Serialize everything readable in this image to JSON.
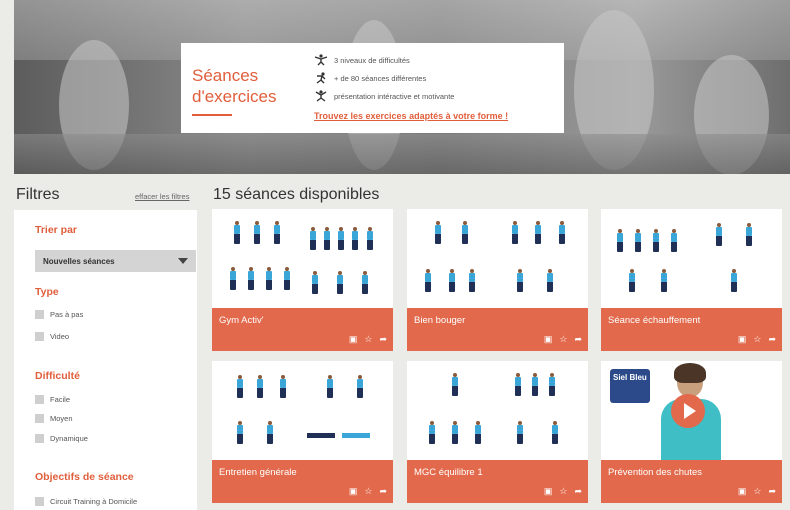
{
  "hero": {
    "title_line1": "Séances",
    "title_line2": "d'exercices",
    "features": [
      {
        "icon": "gymnast-icon",
        "text": "3 niveaux de difficultés"
      },
      {
        "icon": "runner-icon",
        "text": "+ de 80 séances différentes"
      },
      {
        "icon": "star-person-icon",
        "text": "présentation intéractive et motivante"
      }
    ],
    "link": "Trouvez les exercices adaptés à votre forme !"
  },
  "filters": {
    "title": "Filtres",
    "clear": "effacer les filtres",
    "sort_heading": "Trier par",
    "sort_value": "Nouvelles séances",
    "type_heading": "Type",
    "types": [
      "Pas à pas",
      "Video"
    ],
    "difficulty_heading": "Difficulté",
    "difficulties": [
      "Facile",
      "Moyen",
      "Dynamique"
    ],
    "objectives_heading": "Objectifs de séance",
    "objectives": [
      "Circuit Training à Domicile"
    ]
  },
  "main": {
    "count_title": "15 séances disponibles",
    "cards": [
      {
        "title": "Gym Activ'"
      },
      {
        "title": "Bien bouger"
      },
      {
        "title": "Séance échauffement"
      },
      {
        "title": "Entretien générale"
      },
      {
        "title": "MGC équilibre 1"
      },
      {
        "title": "Prévention des chutes"
      }
    ],
    "video_logo": "Siel Bleu"
  },
  "colors": {
    "accent": "#e05e3c",
    "card_bar": "#e2694b",
    "background": "#ebebe7"
  }
}
